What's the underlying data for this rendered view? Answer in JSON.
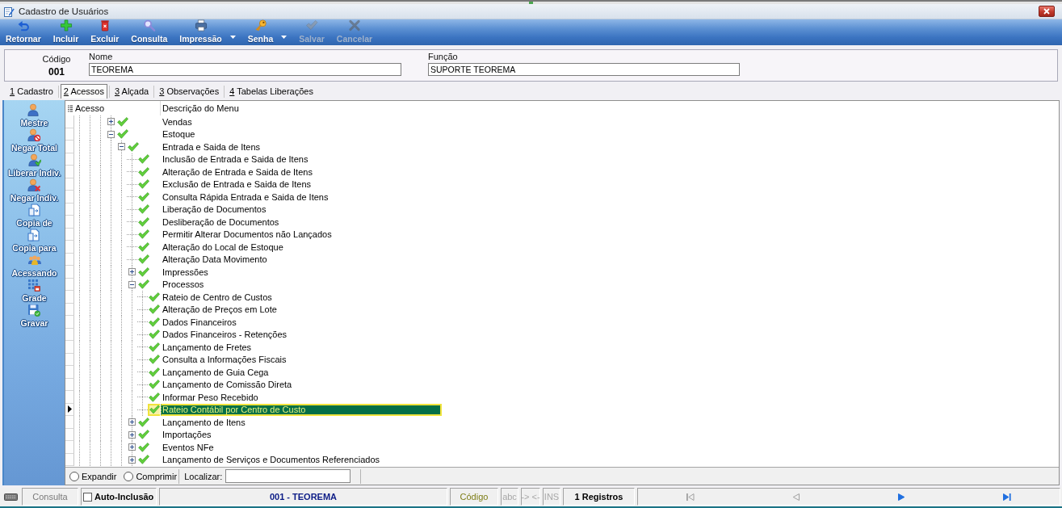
{
  "window": {
    "title": "Cadastro de Usuários"
  },
  "toolbar": {
    "buttons": [
      {
        "label": "Retornar",
        "kind": "back",
        "dropdown": false,
        "disabled": false
      },
      {
        "label": "Incluir",
        "kind": "add",
        "dropdown": false,
        "disabled": false
      },
      {
        "label": "Excluir",
        "kind": "delete",
        "dropdown": false,
        "disabled": false
      },
      {
        "label": "Consulta",
        "kind": "search",
        "dropdown": false,
        "disabled": false
      },
      {
        "label": "Impressão",
        "kind": "print",
        "dropdown": true,
        "disabled": false
      },
      {
        "label": "Senha",
        "kind": "key",
        "dropdown": true,
        "disabled": false
      },
      {
        "label": "Salvar",
        "kind": "save",
        "dropdown": false,
        "disabled": true
      },
      {
        "label": "Cancelar",
        "kind": "cancel",
        "dropdown": false,
        "disabled": true
      }
    ]
  },
  "header": {
    "code": {
      "label": "Código",
      "value": "001"
    },
    "name": {
      "label": "Nome",
      "value": "TEOREMA"
    },
    "function": {
      "label": "Função",
      "value": "SUPORTE TEOREMA"
    }
  },
  "tabs": [
    {
      "label": "1 Cadastro",
      "selected": false
    },
    {
      "label": "2 Acessos",
      "selected": true
    },
    {
      "label": "3 Alçada",
      "selected": false
    },
    {
      "label": "3 Observações",
      "selected": false
    },
    {
      "label": "4 Tabelas Liberações",
      "selected": false
    }
  ],
  "sidebar": {
    "items": [
      {
        "label": "Mestre",
        "kind": "person"
      },
      {
        "label": "Negar Total",
        "kind": "deny"
      },
      {
        "label": "Liberar Indiv.",
        "kind": "allow"
      },
      {
        "label": "Negar Indiv.",
        "kind": "remove"
      },
      {
        "label": "Copia de",
        "kind": "copy"
      },
      {
        "label": "Copia para",
        "kind": "copy"
      },
      {
        "label": "Acessando",
        "kind": "users"
      },
      {
        "label": "Grade",
        "kind": "grid"
      },
      {
        "label": "Gravar",
        "kind": "save"
      }
    ]
  },
  "tree": {
    "columns": [
      "Acesso",
      "Descrição do Menu"
    ],
    "items": [
      {
        "label": "Vendas",
        "checked": true,
        "selected": false,
        "expanded": false
      },
      {
        "label": "Estoque",
        "checked": true,
        "selected": false,
        "expanded": true,
        "children": [
          {
            "label": "Entrada e Saida de Itens",
            "checked": true,
            "selected": false,
            "expanded": true,
            "children": [
              {
                "label": "Inclusão de Entrada e Saida de Itens",
                "checked": true,
                "selected": false
              },
              {
                "label": "Alteração de Entrada e Saida de Itens",
                "checked": true,
                "selected": false
              },
              {
                "label": "Exclusão de Entrada e Saida de Itens",
                "checked": true,
                "selected": false
              },
              {
                "label": "Consulta Rápida Entrada e Saida de Itens",
                "checked": true,
                "selected": false
              },
              {
                "label": "Liberação de Documentos",
                "checked": true,
                "selected": false
              },
              {
                "label": "Desliberação de Documentos",
                "checked": true,
                "selected": false
              },
              {
                "label": "Permitir Alterar Documentos não Lançados",
                "checked": true,
                "selected": false
              },
              {
                "label": "Alteração do Local de Estoque",
                "checked": true,
                "selected": false
              },
              {
                "label": "Alteração Data Movimento",
                "checked": true,
                "selected": false
              },
              {
                "label": "Impressões",
                "checked": true,
                "selected": false,
                "expanded": false
              },
              {
                "label": "Processos",
                "checked": true,
                "selected": false,
                "expanded": true,
                "children": [
                  {
                    "label": "Rateio de Centro de Custos",
                    "checked": true,
                    "selected": false
                  },
                  {
                    "label": "Alteração de Preços em Lote",
                    "checked": true,
                    "selected": false
                  },
                  {
                    "label": "Dados Financeiros",
                    "checked": true,
                    "selected": false
                  },
                  {
                    "label": "Dados Financeiros - Retenções",
                    "checked": true,
                    "selected": false
                  },
                  {
                    "label": "Lançamento de Fretes",
                    "checked": true,
                    "selected": false
                  },
                  {
                    "label": "Consulta a Informações Fiscais",
                    "checked": true,
                    "selected": false
                  },
                  {
                    "label": "Lançamento de Guia Cega",
                    "checked": true,
                    "selected": false
                  },
                  {
                    "label": "Lançamento de Comissão Direta",
                    "checked": true,
                    "selected": false
                  },
                  {
                    "label": "Informar Peso Recebido",
                    "checked": true,
                    "selected": false
                  },
                  {
                    "label": "Rateio Contábil por Centro de Custo",
                    "checked": true,
                    "selected": true
                  }
                ]
              },
              {
                "label": "Lançamento de Itens",
                "checked": true,
                "selected": false,
                "expanded": false
              },
              {
                "label": "Importações",
                "checked": true,
                "selected": false,
                "expanded": false
              },
              {
                "label": "Eventos NFe",
                "checked": true,
                "selected": false,
                "expanded": false
              },
              {
                "label": "Lançamento de Serviços e Documentos Referenciados",
                "checked": true,
                "selected": false,
                "expanded": false
              }
            ]
          }
        ]
      }
    ]
  },
  "tree_footer": {
    "options": [
      {
        "label": "Expandir",
        "selected": false
      },
      {
        "label": "Comprimir",
        "selected": false
      }
    ],
    "search": {
      "label": "Localizar:"
    }
  },
  "status_bar": {
    "mode": "Consulta",
    "auto_insert": {
      "label": "Auto-Inclusão",
      "checked": false
    },
    "record": "001 - TEOREMA",
    "index_button": "Código",
    "indicators": [
      {
        "label": "abc",
        "disabled": true
      },
      {
        "label": "-> <-",
        "disabled": true
      },
      {
        "label": "INS",
        "disabled": true
      }
    ],
    "count": "1 Registros",
    "navigation": [
      {
        "kind": "first",
        "disabled": true
      },
      {
        "kind": "previous",
        "disabled": true
      },
      {
        "kind": "next",
        "disabled": false
      },
      {
        "kind": "last",
        "disabled": false
      }
    ]
  }
}
